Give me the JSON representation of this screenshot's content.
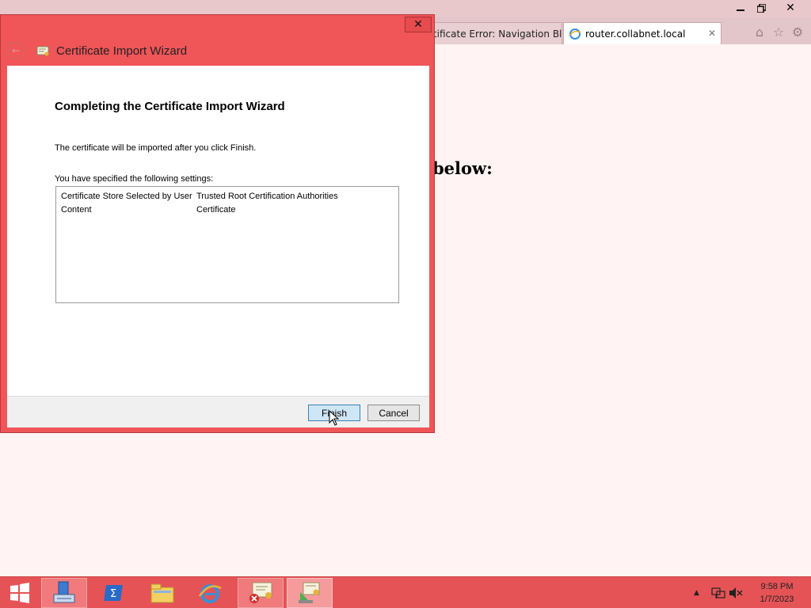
{
  "browser": {
    "tabs": [
      {
        "label": "rtificate Error: Navigation Bl...",
        "active": false
      },
      {
        "label": "router.collabnet.local",
        "active": true
      }
    ],
    "page_text": "below:"
  },
  "dialog": {
    "title": "Certificate Import Wizard",
    "heading": "Completing the Certificate Import Wizard",
    "info": "The certificate will be imported after you click Finish.",
    "settings_label": "You have specified the following settings:",
    "settings": [
      {
        "key": "Certificate Store Selected by User",
        "value": "Trusted Root Certification Authorities"
      },
      {
        "key": "Content",
        "value": "Certificate"
      }
    ],
    "finish_label": "Finish",
    "cancel_label": "Cancel"
  },
  "taskbar": {
    "items": [
      "start-icon",
      "server-manager-icon",
      "powershell-icon",
      "file-explorer-icon",
      "internet-explorer-icon",
      "certificate-error-icon",
      "certificate-import-icon"
    ],
    "time": "9:58 PM",
    "date": "1/7/2023"
  },
  "colors": {
    "accent": "#f05558",
    "taskbar": "#e55356",
    "finish_button": "#cfe6f7"
  }
}
